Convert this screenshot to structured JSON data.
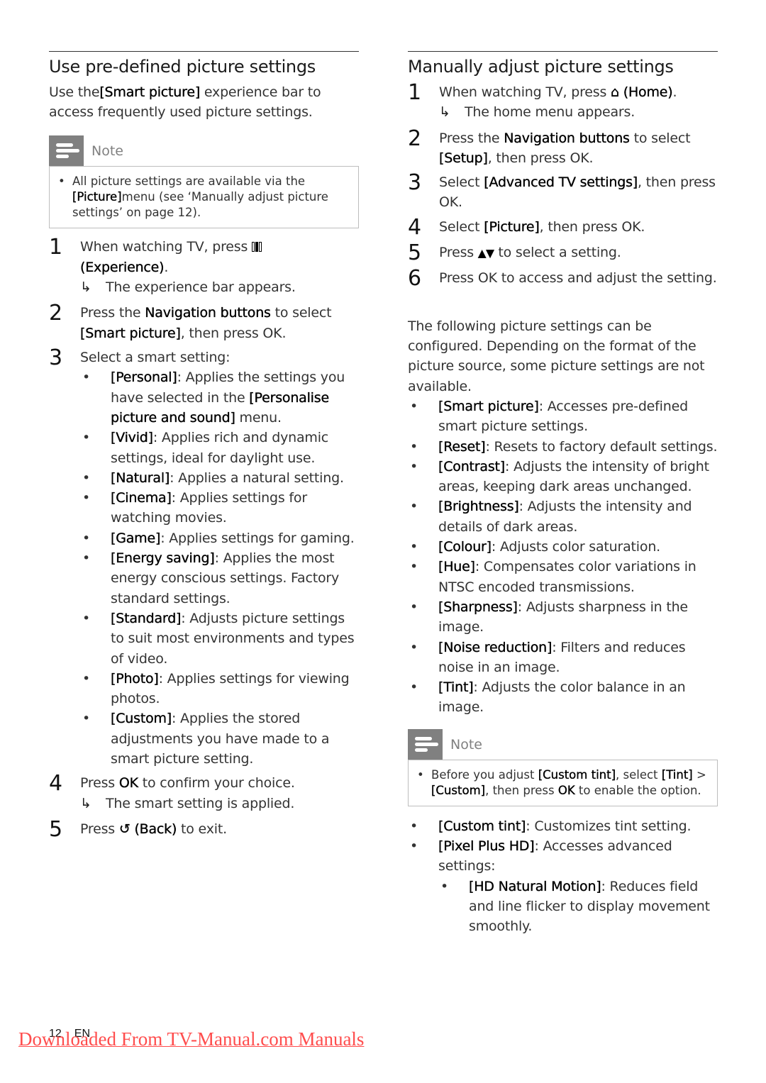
{
  "left": {
    "heading": "Use pre-defined picture settings",
    "intro": {
      "pre": "Use the",
      "bold": "[Smart picture]",
      "post": " experience bar to access frequently used picture settings."
    },
    "note": {
      "label": "Note",
      "bullet": "•",
      "pre": "All picture settings are available via the ",
      "bold": "[Picture]",
      "post": "menu (see ‘Manually adjust picture settings’ on page 12)."
    },
    "steps": [
      {
        "num": "1",
        "pre": "When watching TV, press ",
        "icon": "experience-icon",
        "bold": "(Experience)",
        "post": ".",
        "result": "The experience bar appears."
      },
      {
        "num": "2",
        "pre": "Press the ",
        "bold1": "Navigation buttons",
        "mid": " to select ",
        "bold2": "[Smart picture]",
        "post": ", then press OK."
      },
      {
        "num": "3",
        "text": "Select a smart setting:"
      },
      {
        "num": "4",
        "pre": "Press ",
        "bold": "OK",
        "post": " to confirm your choice.",
        "result": "The smart setting is applied."
      },
      {
        "num": "5",
        "pre": "Press ",
        "icon": "back-icon",
        "bold": "(Back)",
        "post": " to exit."
      }
    ],
    "smart_settings": [
      {
        "name": "[Personal]",
        "desc": ": Applies the settings you have selected in the ",
        "bold2": "[Personalise picture and sound]",
        "desc2": " menu."
      },
      {
        "name": "[Vivid]",
        "desc": ": Applies rich and dynamic settings, ideal for daylight use."
      },
      {
        "name": "[Natural]",
        "desc": ": Applies a natural setting."
      },
      {
        "name": "[Cinema]",
        "desc": ": Applies settings for watching movies."
      },
      {
        "name": "[Game]",
        "desc": ": Applies settings for gaming."
      },
      {
        "name": "[Energy saving]",
        "desc": ": Applies the most energy conscious settings. Factory standard settings."
      },
      {
        "name": "[Standard]",
        "desc": ": Adjusts picture settings to suit most environments and types of video."
      },
      {
        "name": "[Photo]",
        "desc": ": Applies settings for viewing photos."
      },
      {
        "name": "[Custom]",
        "desc": ": Applies the stored adjustments you have made to a smart picture setting."
      }
    ]
  },
  "right": {
    "heading": "Manually adjust picture settings",
    "steps": [
      {
        "num": "1",
        "pre": "When watching TV, press ",
        "icon": "home-icon",
        "bold": "(Home)",
        "post": ".",
        "result": "The home menu appears."
      },
      {
        "num": "2",
        "pre": "Press the ",
        "bold1": "Navigation buttons",
        "mid": " to select ",
        "bold2": "[Setup]",
        "post": ", then press OK."
      },
      {
        "num": "3",
        "pre": "Select ",
        "bold": "[Advanced TV settings]",
        "post": ", then press OK."
      },
      {
        "num": "4",
        "pre": "Select ",
        "bold": "[Picture]",
        "post": ", then press OK."
      },
      {
        "num": "5",
        "pre": "Press ",
        "icon": "up-down-icon",
        "post": " to select a setting."
      },
      {
        "num": "6",
        "pre": "Press OK to access and adjust the setting."
      }
    ],
    "intro": "The following picture settings can be configured. Depending on the format of the picture source, some picture settings are not available.",
    "settings": [
      {
        "name": "[Smart picture]",
        "desc": ": Accesses pre-defined smart picture settings."
      },
      {
        "name": "[Reset]",
        "desc": ": Resets to factory default settings."
      },
      {
        "name": "[Contrast]",
        "desc": ": Adjusts the intensity of bright areas, keeping dark areas unchanged."
      },
      {
        "name": "[Brightness]",
        "desc": ": Adjusts the intensity and details of dark areas."
      },
      {
        "name": "[Colour]",
        "desc": ": Adjusts color saturation."
      },
      {
        "name": "[Hue]",
        "desc": ": Compensates color variations in NTSC encoded transmissions."
      },
      {
        "name": "[Sharpness]",
        "desc": ": Adjusts sharpness in the image."
      },
      {
        "name": "[Noise reduction]",
        "desc": ": Filters and reduces noise in an image."
      },
      {
        "name": "[Tint]",
        "desc": ": Adjusts the color balance in an image."
      }
    ],
    "note": {
      "label": "Note",
      "bullet": "•",
      "pre": "Before you adjust ",
      "bold1": "[Custom tint]",
      "mid": ", select ",
      "bold2": "[Tint]",
      "mid2": " > ",
      "bold3": "[Custom]",
      "mid3": ", then press ",
      "bold4": "OK",
      "post": " to enable the option."
    },
    "settings2": [
      {
        "name": "[Custom tint]",
        "desc": ": Customizes tint setting."
      },
      {
        "name": "[Pixel Plus HD]",
        "desc": ": Accesses advanced settings:"
      }
    ],
    "sub_settings": [
      {
        "name": "[HD Natural Motion]",
        "desc": ": Reduces field and line flicker to display movement smoothly."
      }
    ]
  },
  "footer": {
    "page_number": "12",
    "language": "EN",
    "watermark": "Downloaded From TV-Manual.com Manuals"
  },
  "glyphs": {
    "bullet": "•",
    "result_arrow": "↳",
    "home": "⌂",
    "back": "↺",
    "updown": "▲▼"
  }
}
